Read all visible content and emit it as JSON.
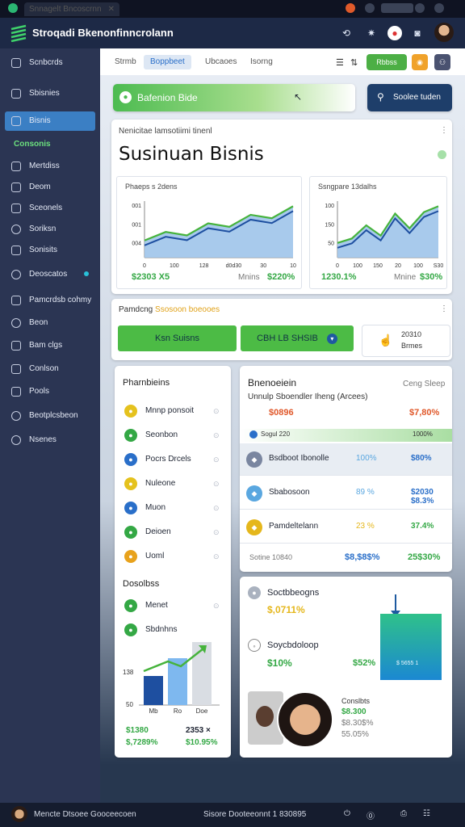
{
  "browser": {
    "tab_title": "Snnagelt Bncoscrnn",
    "url_text": ""
  },
  "app": {
    "title": "Stroqadi Bkenonfinncrolann"
  },
  "sidebar": {
    "items": [
      {
        "label": "Scnbcrds",
        "icon": "grid-icon"
      },
      {
        "label": "Sbisnies",
        "icon": "chart-icon"
      },
      {
        "label": "Bisnis",
        "icon": "table-icon"
      }
    ],
    "section": "Consonis",
    "items2": [
      {
        "label": "Mertdiss",
        "icon": "list-icon"
      },
      {
        "label": "Deom",
        "icon": "doc-icon"
      },
      {
        "label": "Sceonels",
        "icon": "box-icon"
      },
      {
        "label": "Soriksn",
        "icon": "clock-icon"
      },
      {
        "label": "Sonisits",
        "icon": "calendar-icon"
      },
      {
        "label": "Deoscatos",
        "icon": "search-icon"
      },
      {
        "label": "Pamcrdsb cohmy",
        "icon": "pen-icon"
      },
      {
        "label": "Beon",
        "icon": "circle-icon"
      },
      {
        "label": "Bam clgs",
        "icon": "mail-icon"
      },
      {
        "label": "Conlson",
        "icon": "wrench-icon"
      },
      {
        "label": "Pools",
        "icon": "page-icon"
      },
      {
        "label": "Beotplcsbeon",
        "icon": "gear-icon"
      },
      {
        "label": "Nsenes",
        "icon": "globe-icon"
      }
    ]
  },
  "tabs": {
    "items": [
      "Strmb",
      "Boppbeet",
      "Ubcaoes",
      "Isorng"
    ],
    "action_btn": "Rbbss"
  },
  "banner": {
    "label": "Bafenion Bide",
    "search_btn": "Soolee tuden"
  },
  "summary": {
    "subtitle": "Nenicitae lamsotiimi tinenl",
    "title": "Susinuan Bisnis"
  },
  "chart1": {
    "title": "Phaeps s 2dens",
    "ylabels": [
      "001",
      "001",
      "004"
    ],
    "xlabels": [
      "0",
      "100",
      "128",
      "d0d30",
      "30",
      "10"
    ],
    "val": "$2303 X5",
    "meta_label": "Mnins",
    "meta_val": "$220%"
  },
  "chart2": {
    "title": "Ssngpare 13dalhs",
    "ylabels": [
      "100",
      "150",
      "50"
    ],
    "xlabels": [
      "0",
      "100",
      "150",
      "20",
      "100",
      "S30"
    ],
    "val": "1230.1%",
    "meta_label": "Mnine",
    "meta_val": "$30%"
  },
  "actions": {
    "header": "Pamdcng ",
    "header_accent": "Ssosoon boeooes",
    "btn1": "Ksn Suisns",
    "btn2": "CBH LB SHSIB",
    "card_line1": "20310",
    "card_line2": "Brmes"
  },
  "left_list": {
    "header": "Pharnbieins",
    "items": [
      {
        "label": "Mnnp ponsoit",
        "color": "#e5c21e"
      },
      {
        "label": "Seonbon",
        "color": "#34a845"
      },
      {
        "label": "Pocrs Drcels",
        "color": "#2a6fc9"
      },
      {
        "label": "Nuleone",
        "color": "#e5c21e"
      },
      {
        "label": "Muon",
        "color": "#2a6fc9"
      },
      {
        "label": "Deioen",
        "color": "#34a845"
      },
      {
        "label": "Uoml",
        "color": "#e8a21c"
      }
    ],
    "section": "Dosolbss",
    "items2": [
      {
        "label": "Menet",
        "color": "#34a845"
      },
      {
        "label": "Sbdnhns",
        "color": "#34a845"
      }
    ],
    "chart_y": "138",
    "chart_x0": "50",
    "xlabels": [
      "Mb",
      "Ro",
      "Doe"
    ],
    "f1": "$1380",
    "f1b": "$,7289%",
    "f2": "2353 ×",
    "f2b": "$10.95%"
  },
  "right_table": {
    "title": "Bnenoeiein",
    "meta": "Ceng Sleep",
    "subtitle": "Unnulp Sboendler Iheng (Arcees)",
    "v1": "$0896",
    "v2": "$7,80%",
    "strip_left": "Sogul 220",
    "strip_right": "1000%",
    "rows": [
      {
        "label": "Bsdboot Ibonolle",
        "mid": "100%",
        "right": "$80%"
      },
      {
        "label": "Sbabosoon",
        "mid": "89 %",
        "right": "$2030 $8.3%"
      },
      {
        "label": "Pamdeltelann",
        "mid": "23 %",
        "right": "37.4%"
      }
    ],
    "footer_label": "Sotine 10840",
    "footer_mid": "$8,$8$%",
    "footer_right": "25$30%"
  },
  "lower_right": {
    "item1": "Soctbbeogns",
    "item1v": "$,0711%",
    "item2": "Soycbdoloop",
    "item2v": "$10%",
    "item2v2": "$52%",
    "panel_val": "$ 5655 1",
    "profile_label": "Conslbts",
    "profile_v1": "$8.300",
    "profile_v2": "$8.30$%",
    "profile_v3": "55.05%"
  },
  "bottom": {
    "left": "Mencte Dtsoee Gooceecoen",
    "right": "Sisore Dooteeonnt 1 830895"
  },
  "chart_data": [
    {
      "type": "area",
      "title": "Phaeps s 2dens",
      "series": [
        {
          "values": [
            2,
            3,
            2.6,
            4,
            3.6,
            5,
            4.6,
            6
          ]
        }
      ]
    },
    {
      "type": "area",
      "title": "Ssngpare 13dalhs",
      "series": [
        {
          "values": [
            2,
            2.6,
            4.4,
            3,
            6,
            4,
            6.2,
            7
          ]
        }
      ]
    }
  ],
  "colors": {
    "accent": "#34a845",
    "brand": "#1d2946",
    "primary": "#2a6fc9"
  }
}
